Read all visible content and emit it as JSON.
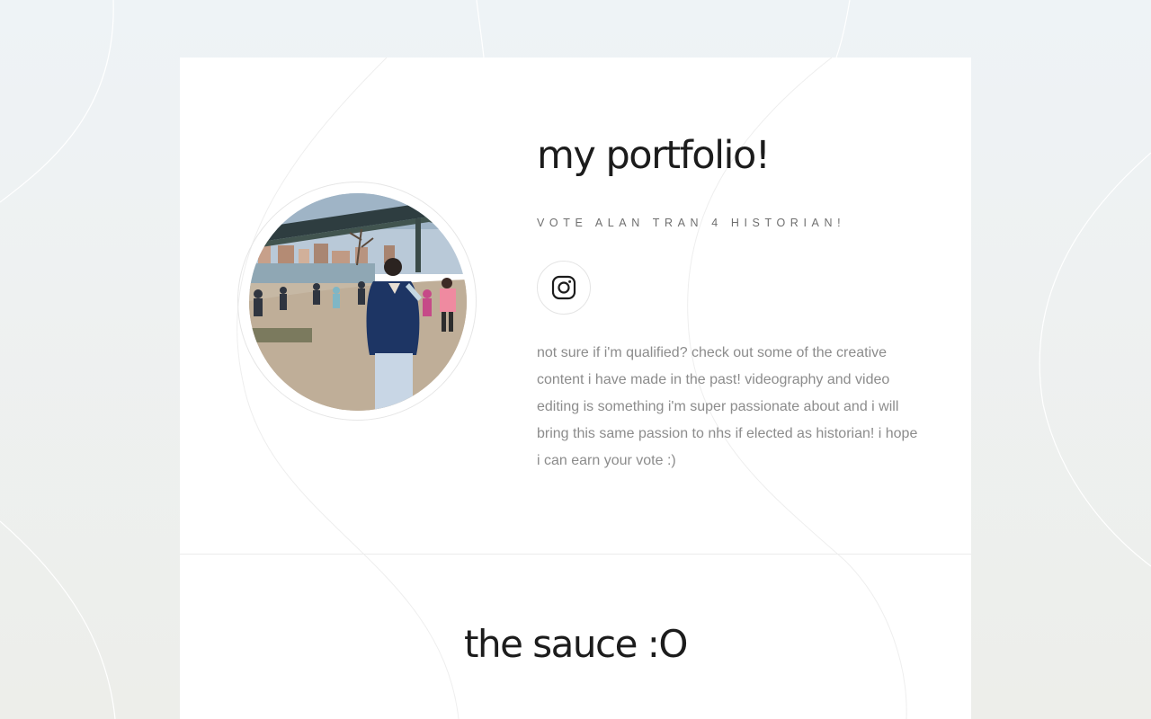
{
  "hero": {
    "title": "my portfolio!",
    "subtitle": "VOTE ALAN TRAN 4 HISTORIAN!",
    "social": {
      "icon": "instagram-icon"
    },
    "bio": "not sure if i'm qualified? check out some of the creative content i have made in the past! videography and video editing is something i'm super passionate about and i will bring this same passion to nhs if elected as historian! i hope i can earn your vote :)"
  },
  "section": {
    "title": "the sauce :O"
  },
  "colors": {
    "page_background_top": "#eef3f6",
    "page_background_bottom": "#edeeea",
    "card_background": "#ffffff",
    "heading": "#1c1c1c",
    "subtitle": "#6f6f6f",
    "body_text": "#8c8c8c"
  }
}
